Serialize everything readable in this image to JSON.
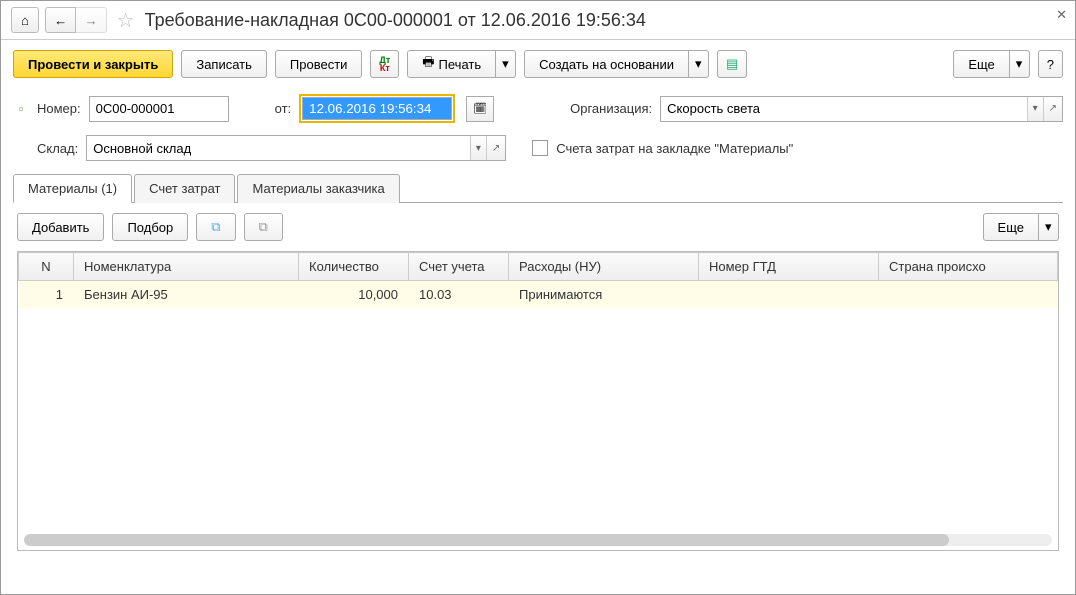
{
  "title": "Требование-накладная 0С00-000001 от 12.06.2016 19:56:34",
  "toolbar": {
    "post_close": "Провести и закрыть",
    "save": "Записать",
    "post": "Провести",
    "print": "Печать",
    "create_based": "Создать на основании",
    "more": "Еще"
  },
  "form": {
    "number_label": "Номер:",
    "number_value": "0С00-000001",
    "date_label": "от:",
    "date_value": "12.06.2016 19:56:34",
    "org_label": "Организация:",
    "org_value": "Скорость света",
    "warehouse_label": "Склад:",
    "warehouse_value": "Основной склад",
    "accounts_tab_hint": "Счета затрат на закладке \"Материалы\""
  },
  "tabs": {
    "materials": "Материалы (1)",
    "cost_account": "Счет затрат",
    "customer_materials": "Материалы заказчика"
  },
  "tab_toolbar": {
    "add": "Добавить",
    "pick": "Подбор",
    "more": "Еще"
  },
  "table": {
    "headers": {
      "n": "N",
      "nomenclature": "Номенклатура",
      "quantity": "Количество",
      "account": "Счет учета",
      "expenses": "Расходы (НУ)",
      "gtd": "Номер ГТД",
      "country": "Страна происхо"
    },
    "rows": [
      {
        "n": "1",
        "nomenclature": "Бензин АИ-95",
        "quantity": "10,000",
        "account": "10.03",
        "expenses": "Принимаются",
        "gtd": "",
        "country": ""
      }
    ]
  }
}
